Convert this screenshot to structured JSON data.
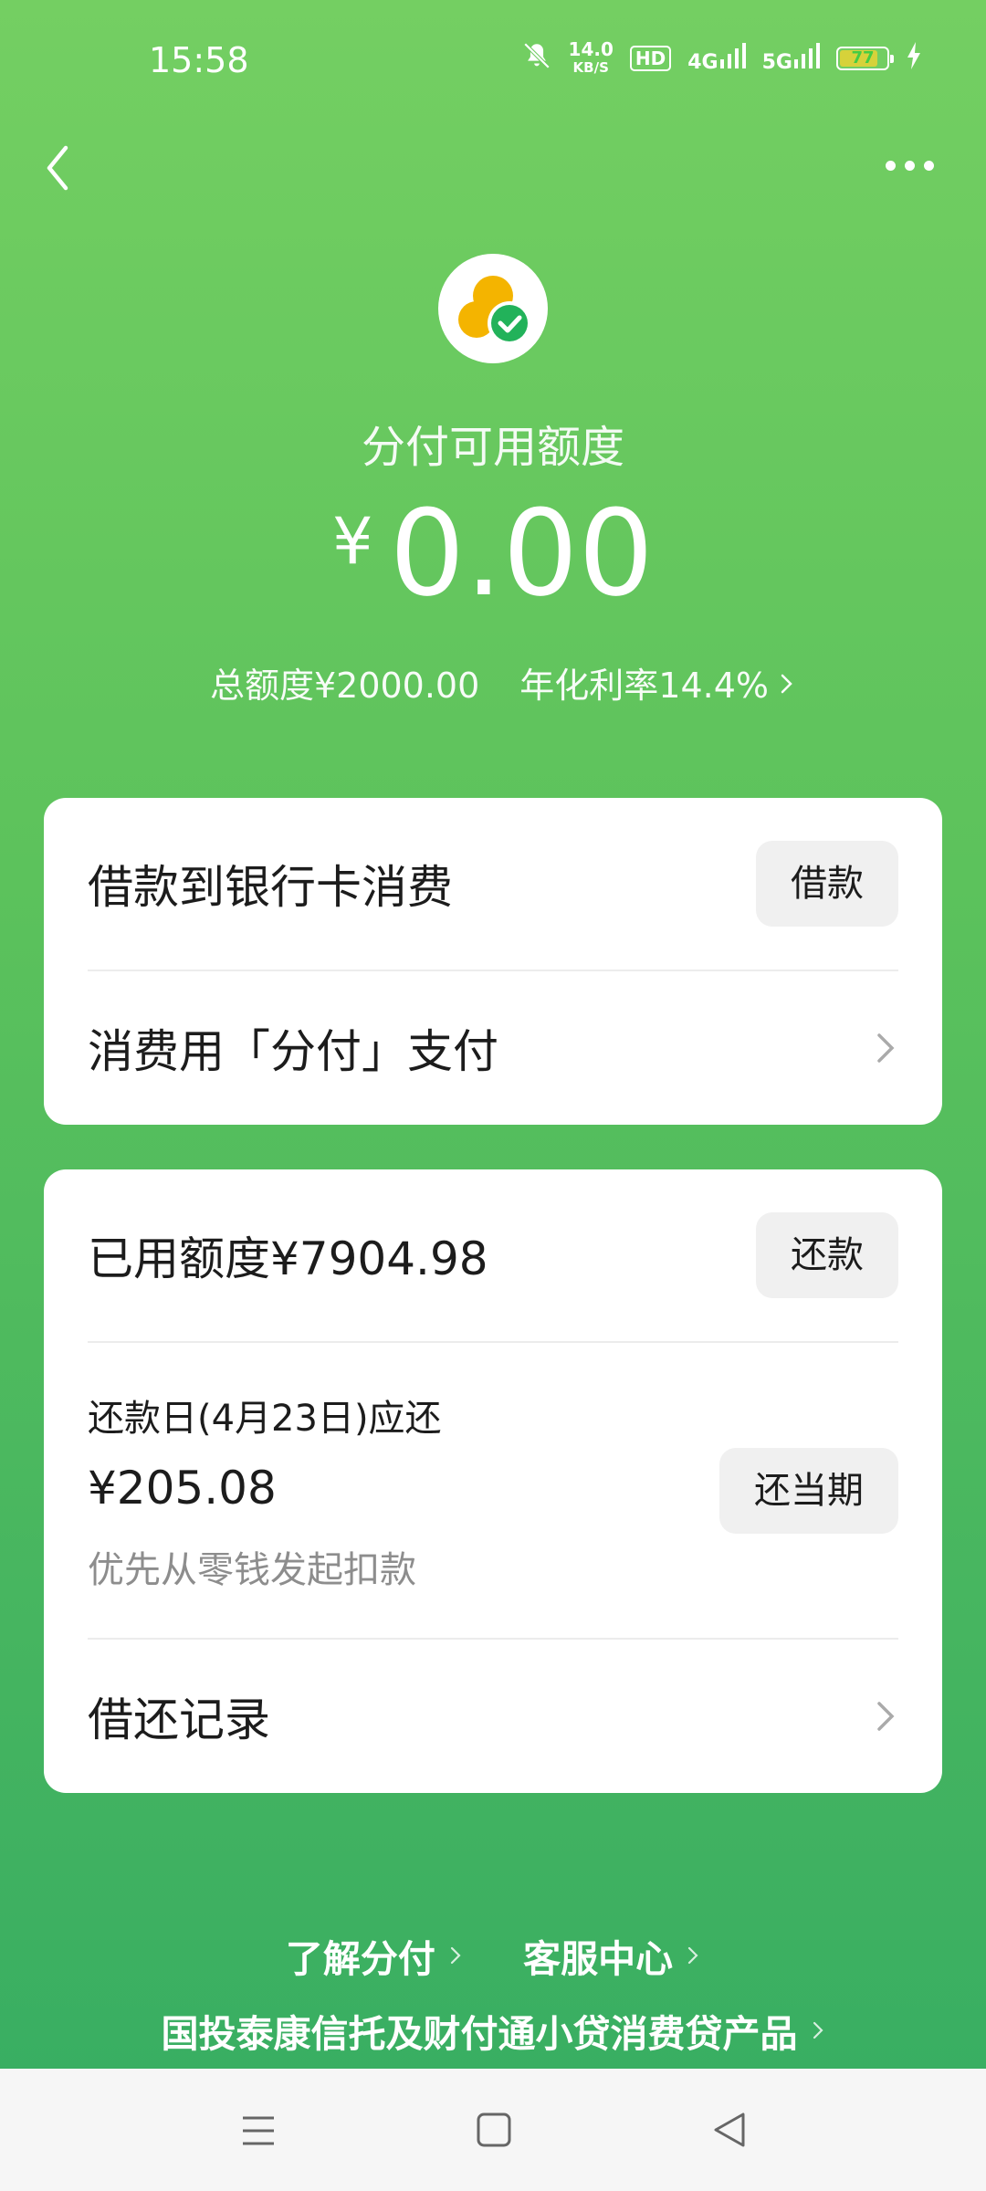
{
  "status_bar": {
    "time": "15:58",
    "net_speed_value": "14.0",
    "net_speed_unit": "KB/S",
    "hd_badge": "HD",
    "signal1": "4G",
    "signal2": "5G",
    "battery_level": "77"
  },
  "header": {
    "title": "分付可用额度",
    "currency": "¥",
    "available_amount": "0.00",
    "total_limit": "总额度¥2000.00",
    "annual_rate": "年化利率14.4%"
  },
  "card1": {
    "loan_label": "借款到银行卡消费",
    "loan_button": "借款",
    "pay_label": "消费用「分付」支付"
  },
  "card2": {
    "used_label": "已用额度¥7904.98",
    "repay_button": "还款",
    "due_label": "还款日(4月23日)应还",
    "due_amount": "¥205.08",
    "due_note": "优先从零钱发起扣款",
    "repay_current_button": "还当期",
    "records_label": "借还记录"
  },
  "footer": {
    "learn_link": "了解分付",
    "service_link": "客服中心",
    "product_link": "国投泰康信托及财付通小贷消费贷产品"
  },
  "colors": {
    "bg_top": "#74cf62",
    "bg_bottom": "#35ad62",
    "logo_yellow": "#f4b400",
    "logo_green": "#22b25a"
  }
}
